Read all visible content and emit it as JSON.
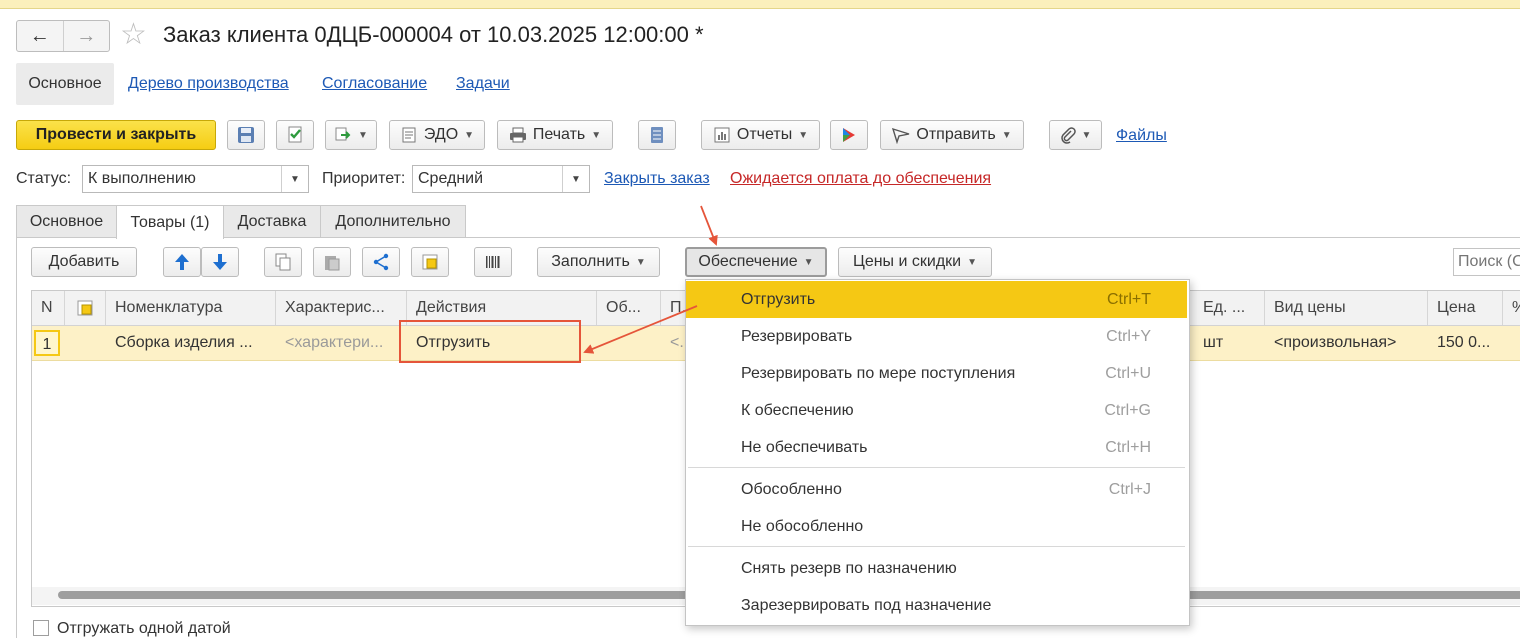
{
  "window": {
    "title": "Заказ клиента 0ДЦБ-000004 от 10.03.2025 12:00:00 *"
  },
  "section_tabs": {
    "main": "Основное",
    "production_tree": "Дерево производства",
    "approval": "Согласование",
    "tasks": "Задачи"
  },
  "toolbar": {
    "post_close": "Провести и закрыть",
    "edo": "ЭДО",
    "print": "Печать",
    "reports": "Отчеты",
    "send": "Отправить",
    "files": "Файлы"
  },
  "status": {
    "label": "Статус:",
    "value": "К выполнению"
  },
  "priority": {
    "label": "Приоритет:",
    "value": "Средний"
  },
  "links": {
    "close_order": "Закрыть заказ",
    "awaiting_payment": "Ожидается оплата до обеспечения"
  },
  "tabs": [
    "Основное",
    "Товары (1)",
    "Доставка",
    "Дополнительно"
  ],
  "grid_toolbar": {
    "add": "Добавить",
    "fill": "Заполнить",
    "provision": "Обеспечение",
    "prices": "Цены и скидки",
    "search_placeholder": "Поиск (Ctrl+F)"
  },
  "grid": {
    "columns": [
      "N",
      "",
      "Номенклатура",
      "Характерис...",
      "Действия",
      "Об...",
      "П...",
      "Ед. ...",
      "Вид цены",
      "Цена",
      "%"
    ],
    "row": {
      "n": "1",
      "nomenclature": "Сборка изделия ...",
      "characteristic": "<характери...",
      "action": "Отгрузить",
      "p": "<...",
      "unit": "шт",
      "price_type": "<произвольная>",
      "price": "150 0..."
    }
  },
  "menu": {
    "items": [
      {
        "label": "Отгрузить",
        "shortcut": "Ctrl+T"
      },
      {
        "label": "Резервировать",
        "shortcut": "Ctrl+Y"
      },
      {
        "label": "Резервировать по мере поступления",
        "shortcut": "Ctrl+U"
      },
      {
        "label": "К обеспечению",
        "shortcut": "Ctrl+G"
      },
      {
        "label": "Не обеспечивать",
        "shortcut": "Ctrl+H"
      },
      {
        "label": "Обособленно",
        "shortcut": "Ctrl+J"
      },
      {
        "label": "Не обособленно",
        "shortcut": ""
      },
      {
        "label": "Снять резерв по назначению",
        "shortcut": ""
      },
      {
        "label": "Зарезервировать под назначение",
        "shortcut": ""
      }
    ]
  },
  "footer": {
    "ship_one_date": "Отгружать одной датой"
  },
  "colors": {
    "primary": "#f5cd13",
    "highlight": "#f5c814",
    "row_selected": "#fdf1c7",
    "link": "#1d59b5",
    "alert_link": "#c62828",
    "annotation": "#e5553a"
  },
  "icons": [
    "back-arrow-icon",
    "forward-arrow-icon",
    "star-icon",
    "save-icon",
    "post-icon",
    "create-based-icon",
    "edo-icon",
    "print-icon",
    "list-icon",
    "reports-icon",
    "bitrix-icon",
    "send-icon",
    "paperclip-icon",
    "arrow-up-icon",
    "arrow-down-icon",
    "copy-icon",
    "paste-icon",
    "share-icon",
    "select-icon",
    "barcode-icon"
  ]
}
